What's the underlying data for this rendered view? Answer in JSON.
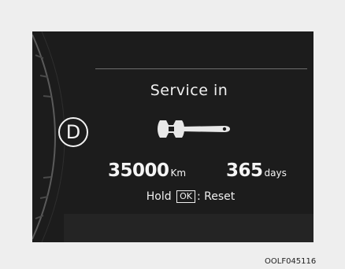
{
  "display": {
    "gear": "D",
    "title": "Service in",
    "distance_value": "35000",
    "distance_unit": "Km",
    "days_value": "365",
    "days_unit": "days",
    "reset_hold": "Hold",
    "reset_key": "OK",
    "reset_action": ": Reset",
    "icon": "wrench-icon"
  },
  "caption": "OOLF045116",
  "colors": {
    "page_background": "#eeeeee",
    "screen_background": "#1c1c1c",
    "text": "#f0f0f0"
  }
}
